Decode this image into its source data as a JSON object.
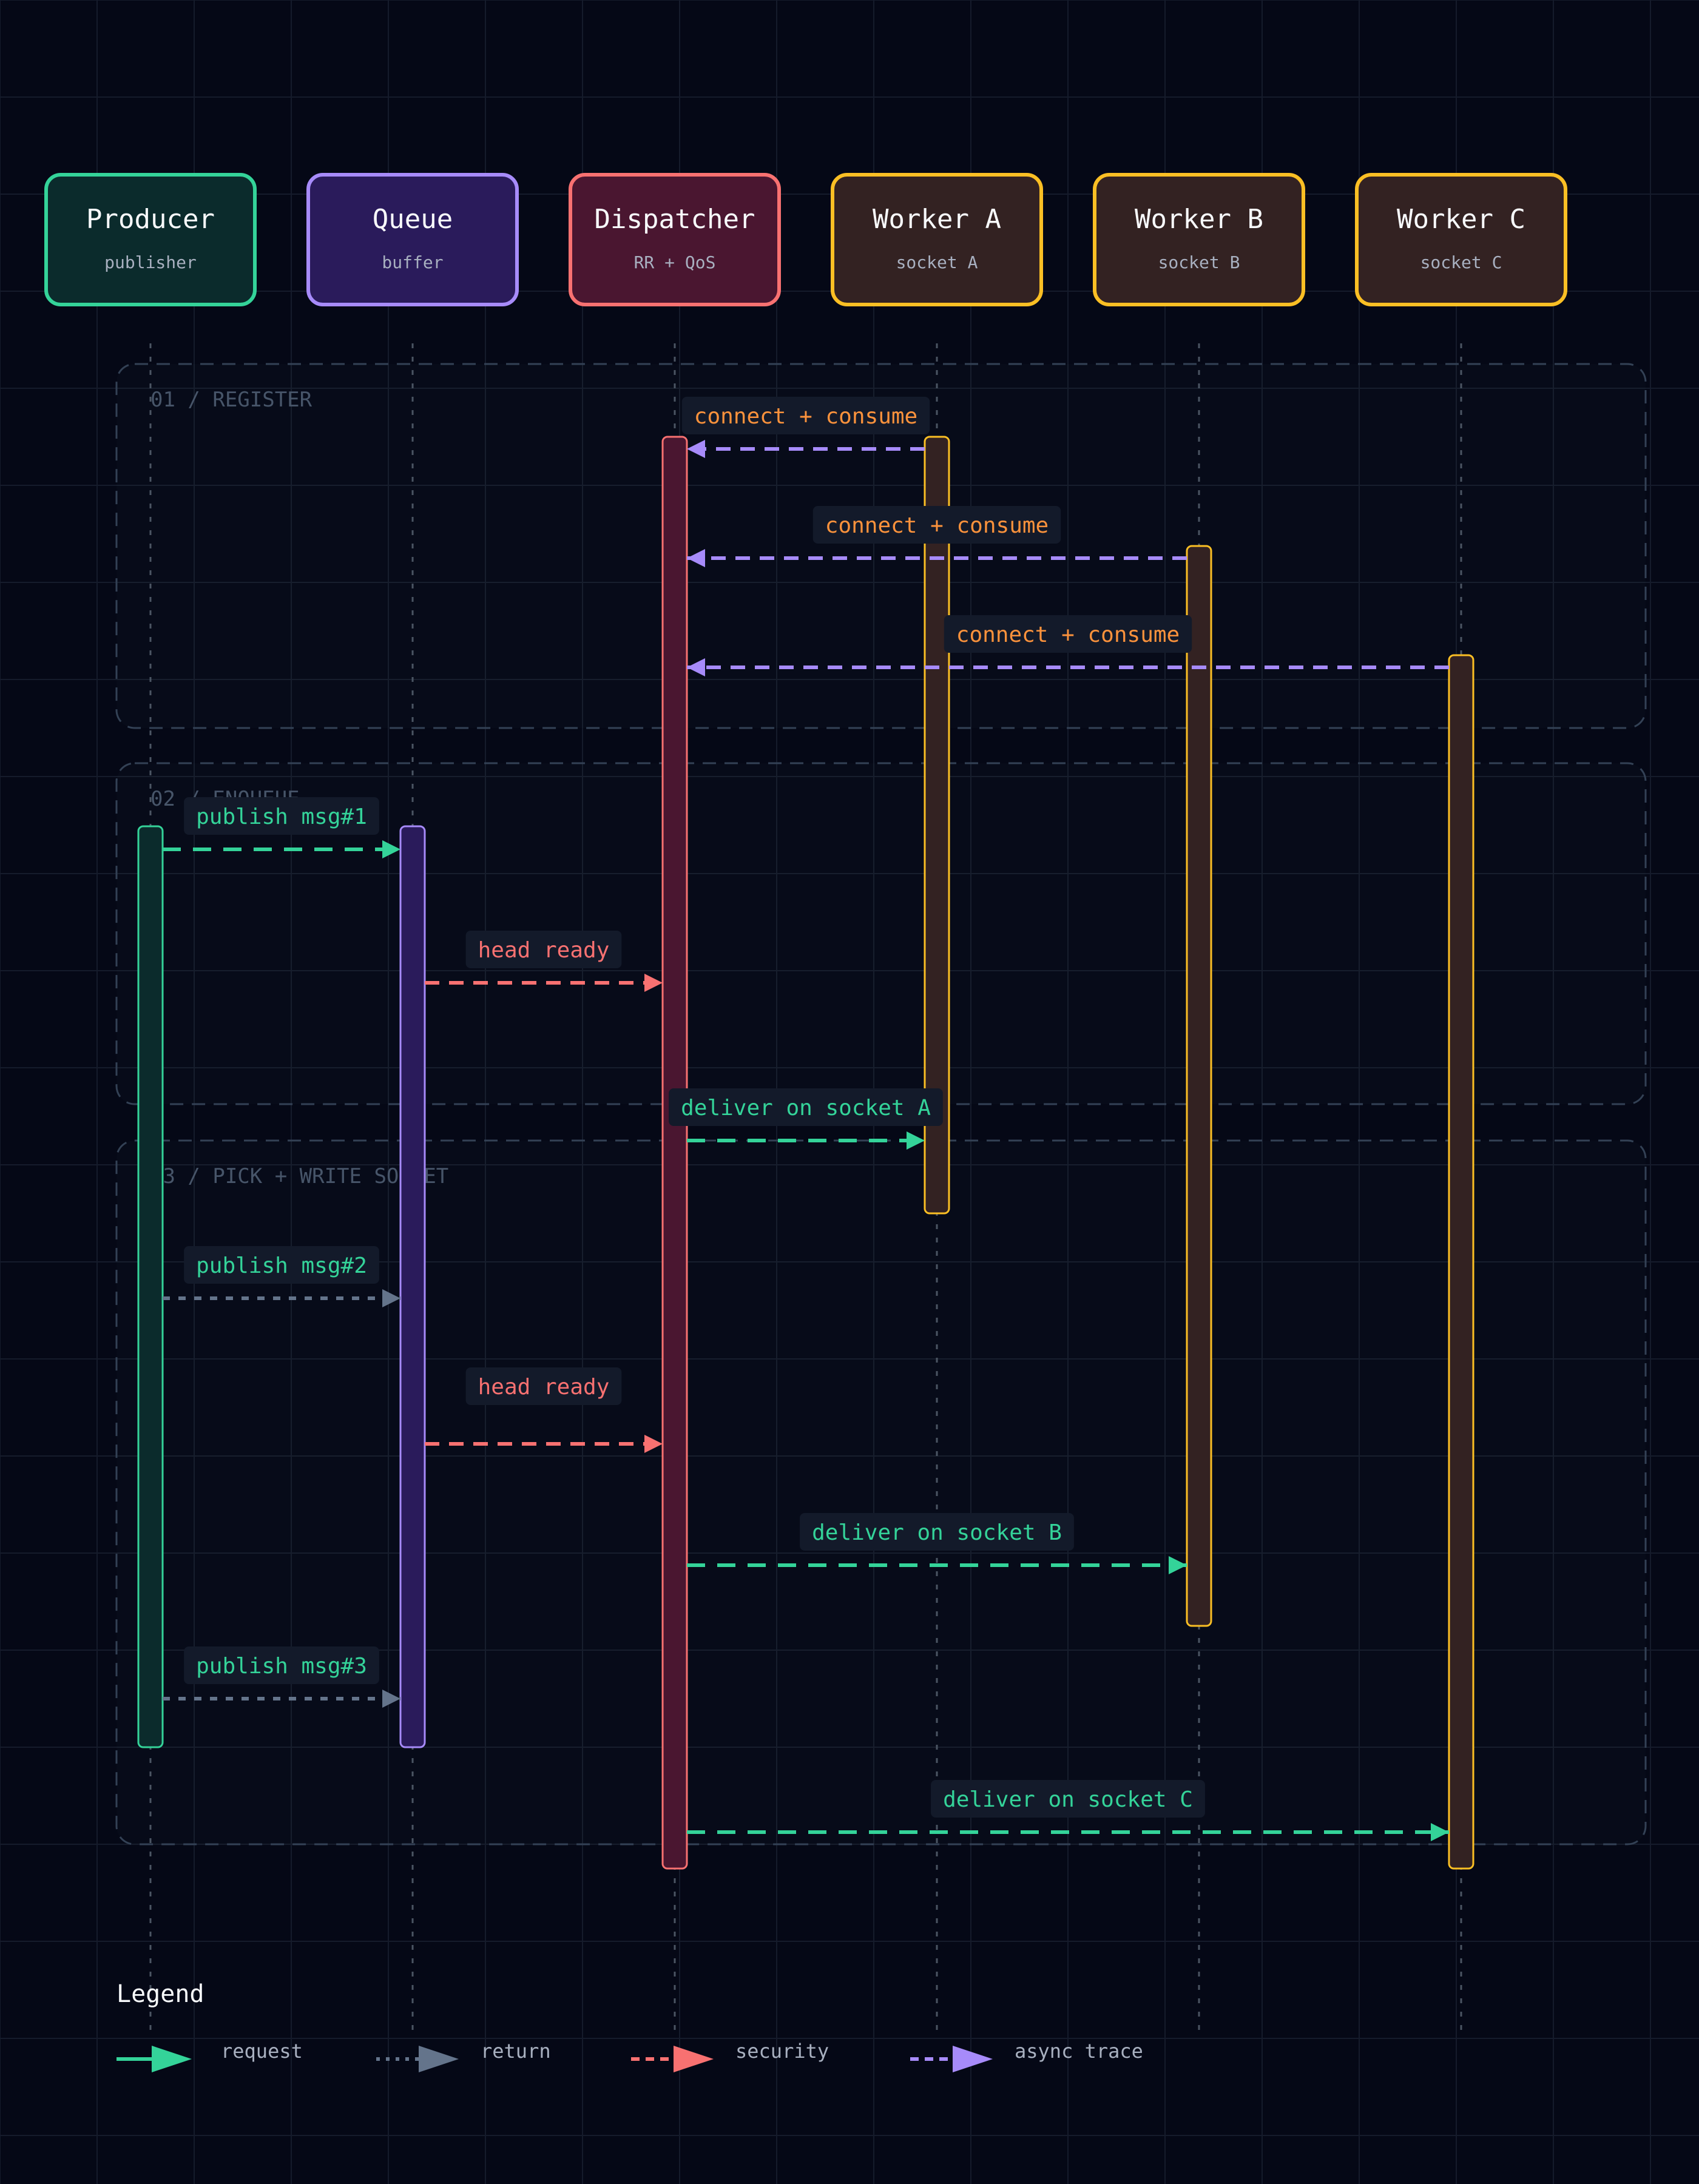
{
  "colors": {
    "background": "#050816",
    "grid": "#151b2b",
    "request": "#34d399",
    "return": "#64748b",
    "security": "#f87171",
    "async": "#a78bfa",
    "label_orange": "#fb923c",
    "section_text": "#475569",
    "section_border": "#334155",
    "lifeline": "#4b5563",
    "label_bg": "#131a2a"
  },
  "participants": [
    {
      "id": "producer",
      "title": "Producer",
      "subtitle": "publisher",
      "border": "#34d399",
      "fill": "#0b2b2c"
    },
    {
      "id": "queue",
      "title": "Queue",
      "subtitle": "buffer",
      "border": "#a78bfa",
      "fill": "#2a1b5b"
    },
    {
      "id": "dispatcher",
      "title": "Dispatcher",
      "subtitle": "RR + QoS",
      "border": "#f87171",
      "fill": "#4a1630"
    },
    {
      "id": "worker_a",
      "title": "Worker A",
      "subtitle": "socket A",
      "border": "#fbbf24",
      "fill": "#332222"
    },
    {
      "id": "worker_b",
      "title": "Worker B",
      "subtitle": "socket B",
      "border": "#fbbf24",
      "fill": "#332222"
    },
    {
      "id": "worker_c",
      "title": "Worker C",
      "subtitle": "socket C",
      "border": "#fbbf24",
      "fill": "#332222"
    }
  ],
  "sections": [
    {
      "label": "01 / REGISTER"
    },
    {
      "label": "02 / ENQUEUE"
    },
    {
      "label": "03 / PICK + WRITE SOCKET"
    }
  ],
  "messages": [
    {
      "from": 3,
      "to": 2,
      "label": "connect + consume",
      "style": "async",
      "label_color": "orange"
    },
    {
      "from": 4,
      "to": 2,
      "label": "connect + consume",
      "style": "async",
      "label_color": "orange"
    },
    {
      "from": 5,
      "to": 2,
      "label": "connect + consume",
      "style": "async",
      "label_color": "orange"
    },
    {
      "from": 0,
      "to": 1,
      "label": "publish msg#1",
      "style": "request",
      "label_color": "request"
    },
    {
      "from": 1,
      "to": 2,
      "label": "head ready",
      "style": "security",
      "label_color": "security"
    },
    {
      "from": 2,
      "to": 3,
      "label": "deliver on socket A",
      "style": "request",
      "label_color": "request"
    },
    {
      "from": 0,
      "to": 1,
      "label": "publish msg#2",
      "style": "return",
      "label_color": "request"
    },
    {
      "from": 1,
      "to": 2,
      "label": "head ready",
      "style": "security",
      "label_color": "security"
    },
    {
      "from": 2,
      "to": 4,
      "label": "deliver on socket B",
      "style": "request",
      "label_color": "request"
    },
    {
      "from": 0,
      "to": 1,
      "label": "publish msg#3",
      "style": "return",
      "label_color": "request"
    },
    {
      "from": 2,
      "to": 5,
      "label": "deliver on socket C",
      "style": "request",
      "label_color": "request"
    }
  ],
  "legend": {
    "title": "Legend",
    "items": [
      {
        "label": "request",
        "style": "request"
      },
      {
        "label": "return",
        "style": "return"
      },
      {
        "label": "security",
        "style": "security"
      },
      {
        "label": "async trace",
        "style": "async"
      }
    ]
  }
}
